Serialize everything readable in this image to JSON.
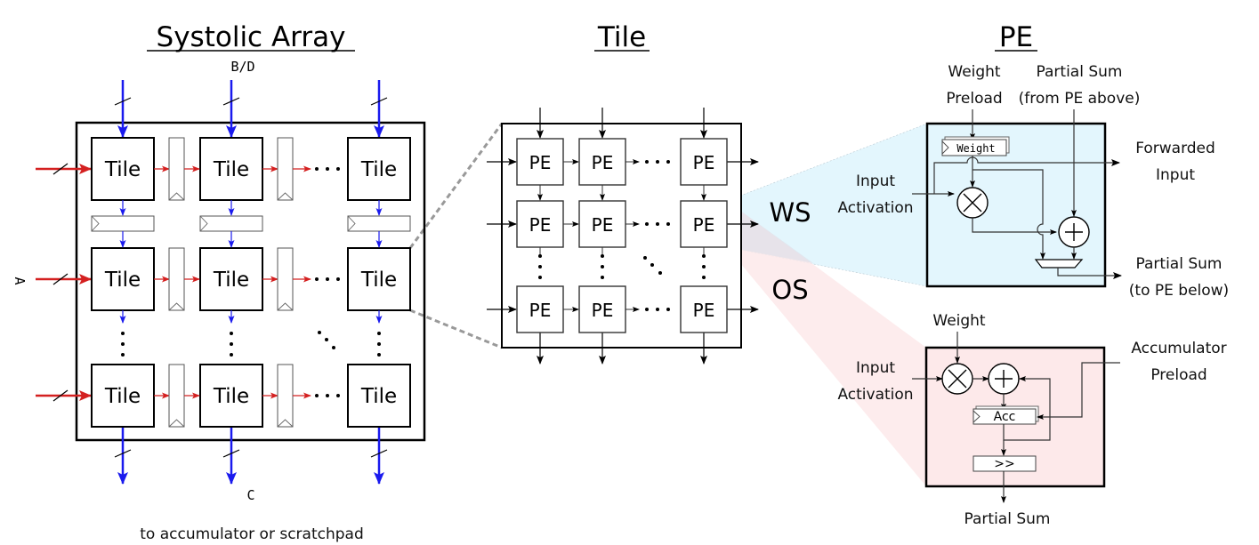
{
  "titles": {
    "systolic_array": "Systolic Array",
    "tile": "Tile",
    "pe": "PE"
  },
  "systolic_array": {
    "input_top_label": "B/D",
    "input_left_label": "A",
    "output_bottom_label": "C",
    "output_caption": "to accumulator or scratchpad",
    "tile_label": "Tile",
    "ellipsis": "...",
    "colors": {
      "a_path": "#d42020",
      "bd_path": "#1a1aee"
    }
  },
  "tile": {
    "pe_label": "PE"
  },
  "dataflows": {
    "ws": {
      "label": "WS",
      "color": "#e3f6fd"
    },
    "os": {
      "label": "OS",
      "color": "#fde9ea"
    }
  },
  "pe_ws": {
    "weight_preload": [
      "Weight",
      "Preload"
    ],
    "partial_sum_in": [
      "Partial Sum",
      "(from PE above)"
    ],
    "input_activation": [
      "Input",
      "Activation"
    ],
    "forwarded_input": [
      "Forwarded",
      "Input"
    ],
    "partial_sum_out": [
      "Partial Sum",
      "(to PE below)"
    ],
    "weight_register": "Weight",
    "mult_symbol": "×",
    "add_symbol": "+"
  },
  "pe_os": {
    "weight": "Weight",
    "input_activation": [
      "Input",
      "Activation"
    ],
    "accumulator_preload": [
      "Accumulator",
      "Preload"
    ],
    "acc_register": "Acc",
    "shift": ">>",
    "partial_sum_out": "Partial Sum"
  }
}
